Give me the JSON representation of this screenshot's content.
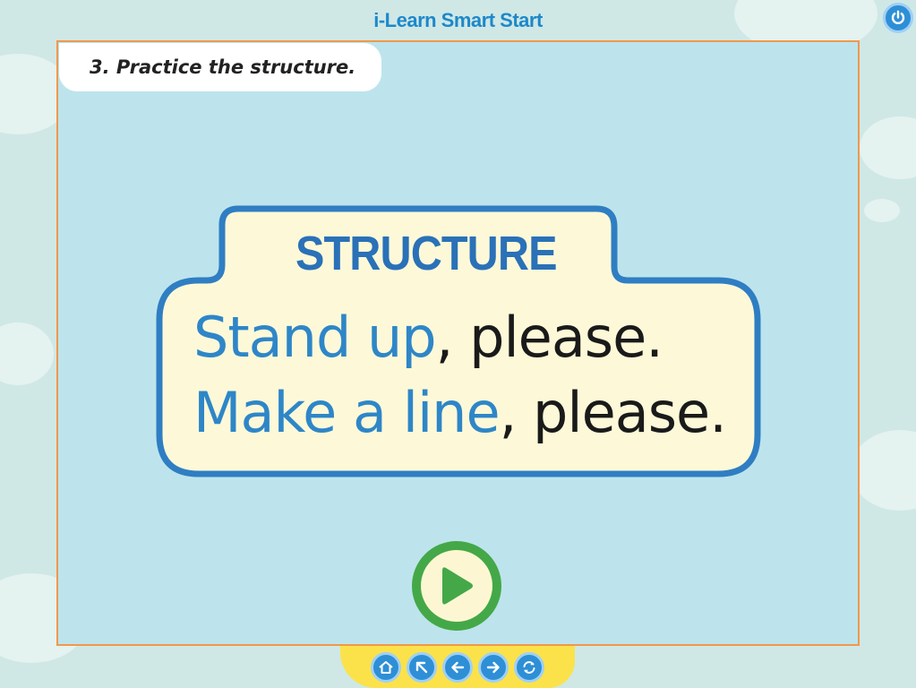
{
  "app": {
    "title": "i-Learn Smart Start"
  },
  "instruction": {
    "text": "3. Practice the structure."
  },
  "card": {
    "heading": "STRUCTURE",
    "line1": {
      "highlight": "Stand up",
      "rest": ", please."
    },
    "line2": {
      "highlight": "Make a line",
      "rest": ", please."
    }
  },
  "icons": {
    "power": "power-icon",
    "play": "play-icon",
    "nav": [
      "home-icon",
      "arrow-up-left-icon",
      "arrow-left-icon",
      "arrow-right-icon",
      "replay-icon"
    ]
  },
  "colors": {
    "stage_bg": "#bde4ec",
    "card_bg": "#fdf9d8",
    "card_border": "#2f7ec3",
    "heading_blue": "#2a71b8",
    "highlight_blue": "#2e86c8",
    "play_green": "#44a848",
    "nav_yellow": "#fbe24a",
    "nav_blue": "#2e8fd6"
  }
}
